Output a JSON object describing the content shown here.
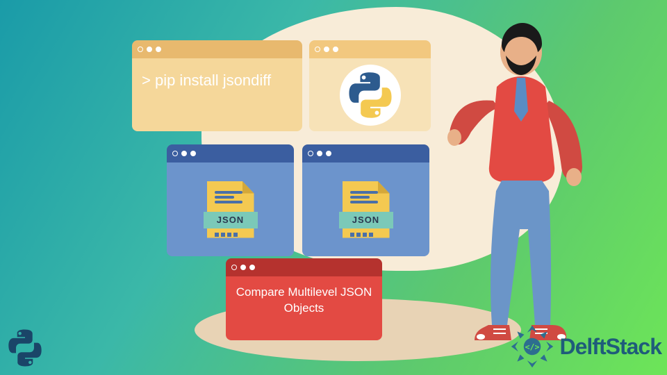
{
  "windows": {
    "pip": {
      "command": "> pip install jsondiff"
    },
    "json_label": "JSON",
    "compare": {
      "text": "Compare Multilevel JSON Objects"
    }
  },
  "brand": {
    "name": "DelftStack"
  },
  "colors": {
    "red": "#e34a43",
    "blue": "#6c94cc",
    "cream": "#f5d79a",
    "teal": "#7bc9b8"
  }
}
